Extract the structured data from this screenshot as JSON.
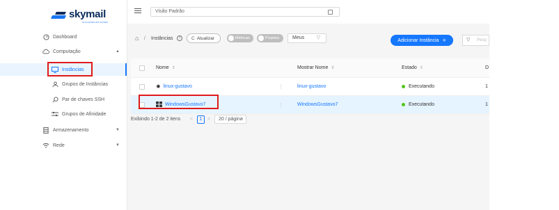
{
  "logo": {
    "name": "skymail",
    "tagline": "SOLUÇÕES EM NUVEM"
  },
  "sidebar": {
    "items": [
      {
        "label": "Dashboard",
        "icon": "dashboard-icon"
      },
      {
        "label": "Computação",
        "icon": "cloud-icon",
        "expanded": true
      },
      {
        "label": "Instâncias",
        "icon": "monitor-icon",
        "active": true
      },
      {
        "label": "Grupos de Instâncias",
        "icon": "users-icon"
      },
      {
        "label": "Par de chaves SSH",
        "icon": "key-icon"
      },
      {
        "label": "Grupos de Afinidade",
        "icon": "affinity-icon"
      },
      {
        "label": "Armazenamento",
        "icon": "storage-icon"
      },
      {
        "label": "Rede",
        "icon": "wifi-icon"
      }
    ]
  },
  "header": {
    "view_value": "Visão Padrão"
  },
  "toolbar": {
    "breadcrumb": "Instâncias",
    "refresh_label": "Atualizar",
    "toggle_metrics": "Métricas",
    "toggle_projects": "Projetos",
    "owner_filter": "Meus",
    "add_label": "Adicionar Instância",
    "search_placeholder": "Pesq"
  },
  "table": {
    "columns": [
      "Nome",
      "Mostrar Nome",
      "Estado",
      "D"
    ],
    "rows": [
      {
        "name": "linux-gustavo",
        "display_name": "linux-gustavo",
        "state": "Executando",
        "extra": "1",
        "icon": "linux-icon"
      },
      {
        "name": "WindowsGustavo7",
        "display_name": "WindowsGustavo7",
        "state": "Executando",
        "extra": "1",
        "icon": "windows-icon",
        "highlighted": true
      }
    ]
  },
  "pagination": {
    "info": "Exibindo 1-2 de 2 itens",
    "current_page": "1",
    "page_size": "20 / página"
  },
  "colors": {
    "accent": "#1677ff",
    "running": "#52c41a",
    "annotation": "#e0191b",
    "highlight_row": "#e6f4ff"
  }
}
